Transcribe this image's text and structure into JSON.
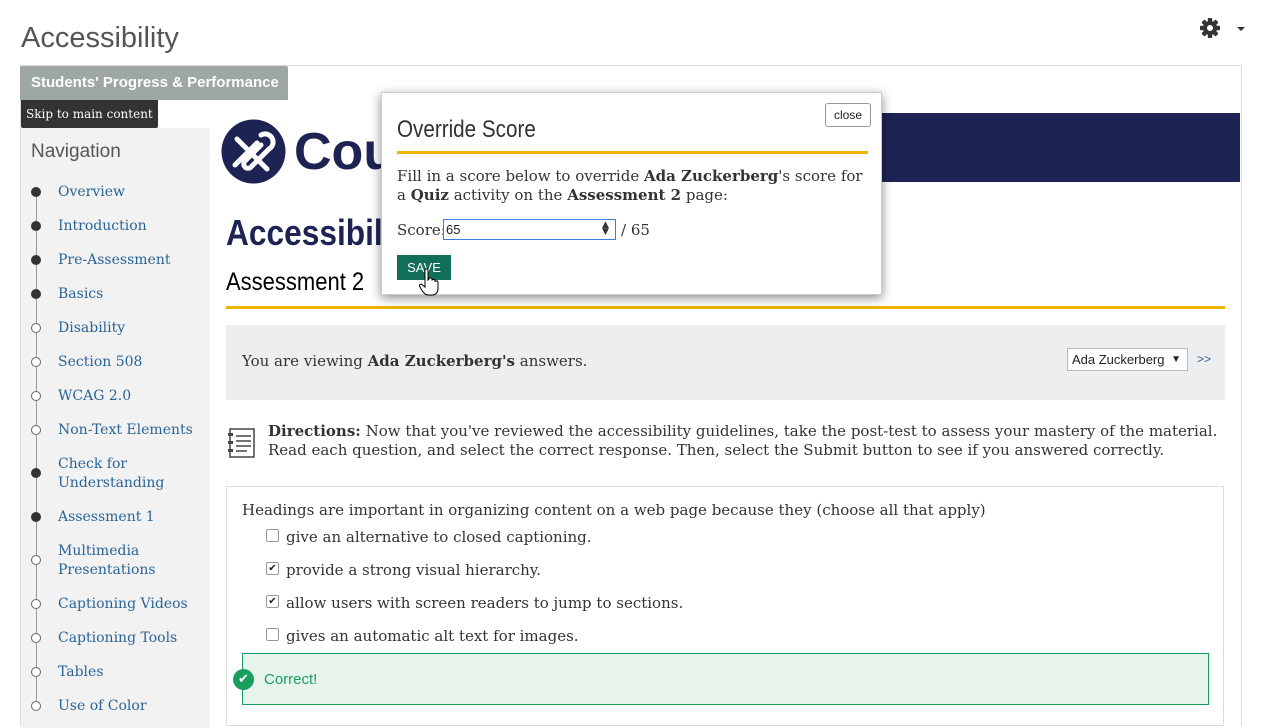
{
  "header": {
    "title": "Accessibility",
    "settings_icon": "gear-icon"
  },
  "tab": {
    "label": "Students' Progress & Performance"
  },
  "skip_link": "Skip to main content",
  "navigation": {
    "heading": "Navigation",
    "items": [
      {
        "label": "Overview",
        "state": "filled"
      },
      {
        "label": "Introduction",
        "state": "filled"
      },
      {
        "label": "Pre-Assessment",
        "state": "filled"
      },
      {
        "label": "Basics",
        "state": "filled"
      },
      {
        "label": "Disability",
        "state": "empty"
      },
      {
        "label": "Section 508",
        "state": "empty"
      },
      {
        "label": "WCAG 2.0",
        "state": "empty"
      },
      {
        "label": "Non-Text Elements",
        "state": "empty"
      },
      {
        "label": "Check for Understanding",
        "state": "filled"
      },
      {
        "label": "Assessment 1",
        "state": "filled"
      },
      {
        "label": "Multimedia Presentations",
        "state": "empty"
      },
      {
        "label": "Captioning Videos",
        "state": "empty"
      },
      {
        "label": "Captioning Tools",
        "state": "empty"
      },
      {
        "label": "Tables",
        "state": "empty"
      },
      {
        "label": "Use of Color",
        "state": "empty"
      }
    ]
  },
  "banner": {
    "logo_text": "Cou",
    "color": "#1d2453"
  },
  "main": {
    "course_title": "Accessibili",
    "page_title": "Assessment 2",
    "viewing": {
      "prefix": "You are viewing ",
      "name": "Ada Zuckerberg's",
      "suffix": " answers.",
      "selected_user": "Ada Zuckerberg",
      "next_label": ">>"
    },
    "directions": {
      "label": "Directions:",
      "text": " Now that you've reviewed the accessibility guidelines, take the post-test to assess your mastery of the material. Read each question, and select the correct response. Then, select the Submit button to see if you answered correctly."
    },
    "question": {
      "text": "Headings are important in organizing content on a web page because they (choose all that apply)",
      "options": [
        {
          "label": "give an alternative to closed captioning.",
          "checked": false
        },
        {
          "label": "provide a strong visual hierarchy.",
          "checked": true
        },
        {
          "label": "allow users with screen readers to jump to sections.",
          "checked": true
        },
        {
          "label": "gives an automatic alt text for images.",
          "checked": false
        }
      ],
      "feedback": "Correct!"
    }
  },
  "modal": {
    "title": "Override Score",
    "close_label": "close",
    "desc_1": "Fill in a score below to override ",
    "desc_name": "Ada Zuckerberg",
    "desc_2": "'s score for a ",
    "desc_activity": "Quiz",
    "desc_3": " activity on the ",
    "desc_page": "Assessment 2",
    "desc_4": " page:",
    "score_label": "Score:",
    "score_value": "65",
    "score_max": "/ 65",
    "save_label": "SAVE"
  },
  "colors": {
    "accent_rule": "#f0b400",
    "save_button": "#126e58",
    "correct": "#19a05f",
    "link": "#2a6496"
  }
}
